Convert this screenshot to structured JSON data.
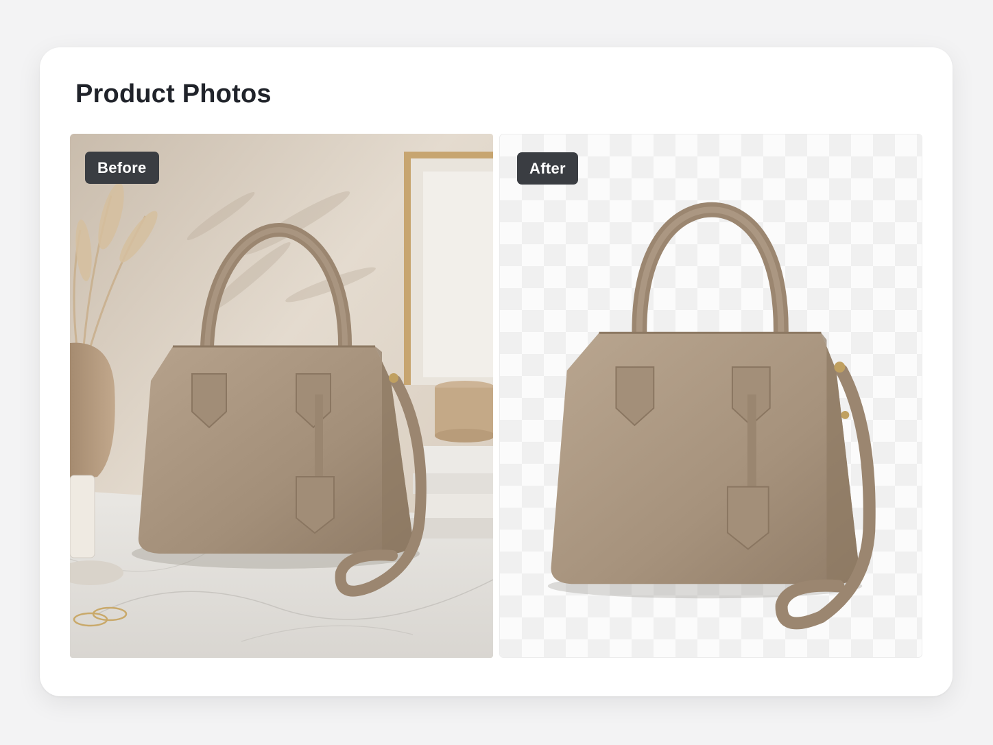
{
  "page": {
    "title": "Product Photos"
  },
  "comparison": {
    "before": {
      "label": "Before",
      "image": "handbag-lifestyle-photo"
    },
    "after": {
      "label": "After",
      "image": "handbag-background-removed"
    }
  },
  "colors": {
    "page_bg": "#f3f3f4",
    "card_bg": "#ffffff",
    "badge_bg": "#3a3d42",
    "badge_text": "#ffffff",
    "title_text": "#20232a",
    "bag_taupe": "#a8937e"
  }
}
